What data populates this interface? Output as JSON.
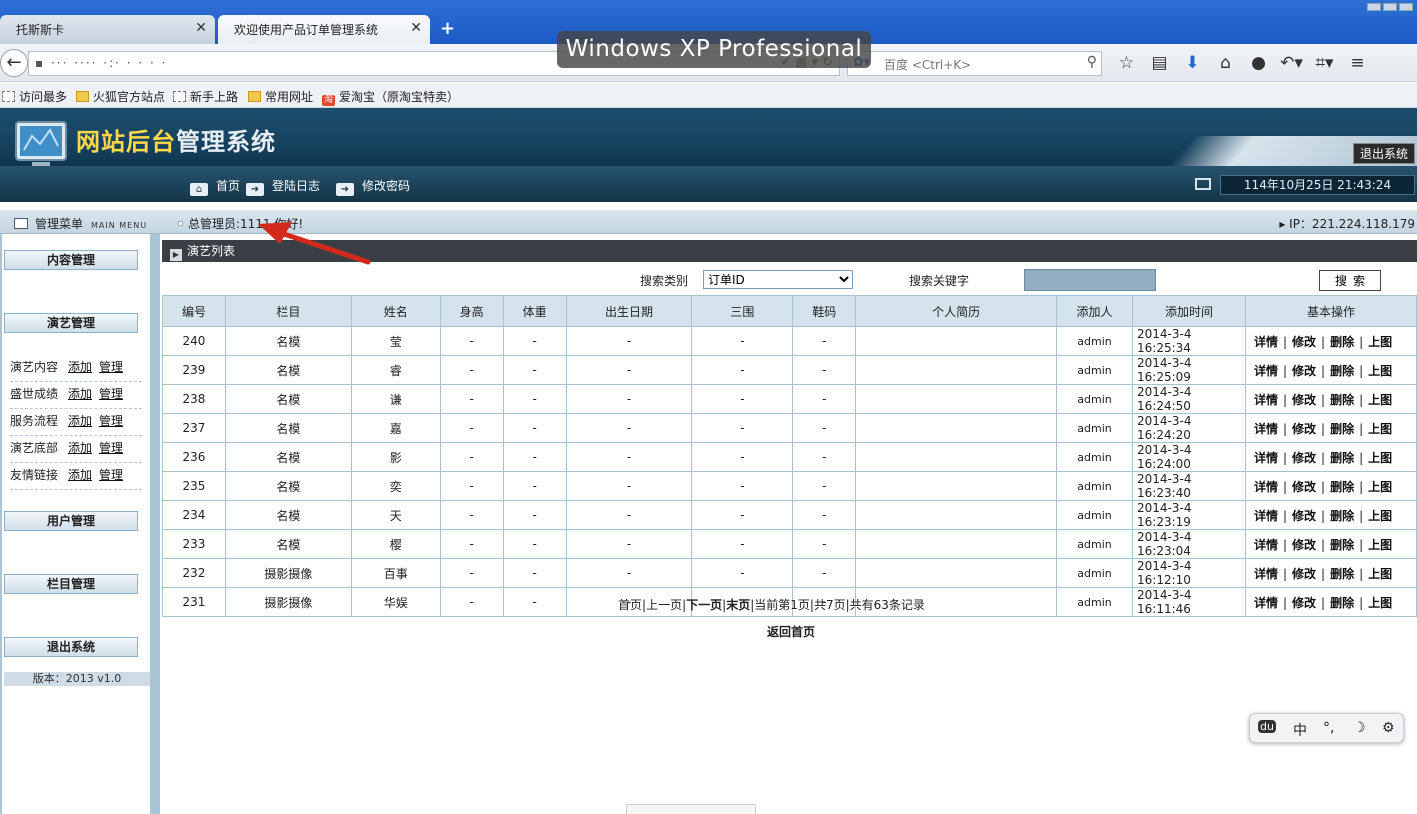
{
  "browser": {
    "tabs": [
      {
        "label": "托斯斯卡",
        "active": false
      },
      {
        "label": "欢迎使用产品订单管理系统",
        "active": true
      }
    ],
    "overlay_banner": "Windows XP Professional",
    "url_masked": "▪ ···   ····  ·:· ·  ·  · ·",
    "search_placeholder": "百度 <Ctrl+K>",
    "bookmarks": [
      "访问最多",
      "火狐官方站点",
      "新手上路",
      "常用网址",
      "爱淘宝（原淘宝特卖）"
    ]
  },
  "header": {
    "logo_part1": "网站后台",
    "logo_part2": "管理系统",
    "logout_label": "退出系统",
    "nav": [
      "首页",
      "登陆日志",
      "修改密码"
    ],
    "datetime": "114年10月25日 21:43:24"
  },
  "welcome_bar": {
    "menu_title": "管理菜单",
    "menu_title_en": "MAIN MENU",
    "greeting": "总管理员:1111 你好!",
    "ip": "IP：221.224.118.179"
  },
  "sidebar": {
    "sections": [
      "内容管理",
      "演艺管理",
      "用户管理",
      "栏目管理",
      "退出系统"
    ],
    "rows": [
      {
        "label": "演艺内容",
        "add": "添加",
        "manage": "管理"
      },
      {
        "label": "盛世成绩",
        "add": "添加",
        "manage": "管理"
      },
      {
        "label": "服务流程",
        "add": "添加",
        "manage": "管理"
      },
      {
        "label": "演艺底部",
        "add": "添加",
        "manage": "管理"
      },
      {
        "label": "友情链接",
        "add": "添加",
        "manage": "管理"
      }
    ],
    "version": "版本：2013 v1.0"
  },
  "main": {
    "panel_title": "演艺列表",
    "search_type_label": "搜索类别",
    "search_type_value": "订单ID",
    "search_keyword_label": "搜索关键字",
    "search_button": "搜索",
    "columns": [
      "编号",
      "栏目",
      "姓名",
      "身高",
      "体重",
      "出生日期",
      "三围",
      "鞋码",
      "个人简历",
      "添加人",
      "添加时间",
      "基本操作"
    ],
    "ops": [
      "详情",
      "修改",
      "删除",
      "上图"
    ],
    "rows": [
      [
        "240",
        "名模",
        "莹",
        "-",
        "-",
        "-",
        "-",
        "-",
        "",
        "admin",
        "2014-3-4 16:25:34"
      ],
      [
        "239",
        "名模",
        "睿",
        "-",
        "-",
        "-",
        "-",
        "-",
        "",
        "admin",
        "2014-3-4 16:25:09"
      ],
      [
        "238",
        "名模",
        "谦",
        "-",
        "-",
        "-",
        "-",
        "-",
        "",
        "admin",
        "2014-3-4 16:24:50"
      ],
      [
        "237",
        "名模",
        "嘉",
        "-",
        "-",
        "-",
        "-",
        "-",
        "",
        "admin",
        "2014-3-4 16:24:20"
      ],
      [
        "236",
        "名模",
        "影",
        "-",
        "-",
        "-",
        "-",
        "-",
        "",
        "admin",
        "2014-3-4 16:24:00"
      ],
      [
        "235",
        "名模",
        "奕",
        "-",
        "-",
        "-",
        "-",
        "-",
        "",
        "admin",
        "2014-3-4 16:23:40"
      ],
      [
        "234",
        "名模",
        "天",
        "-",
        "-",
        "-",
        "-",
        "-",
        "",
        "admin",
        "2014-3-4 16:23:19"
      ],
      [
        "233",
        "名模",
        "樱",
        "-",
        "-",
        "-",
        "-",
        "-",
        "",
        "admin",
        "2014-3-4 16:23:04"
      ],
      [
        "232",
        "摄影摄像",
        "百事",
        "-",
        "-",
        "-",
        "-",
        "-",
        "",
        "admin",
        "2014-3-4 16:12:10"
      ],
      [
        "231",
        "摄影摄像",
        "华娱",
        "-",
        "-",
        "-",
        "-",
        "-",
        "",
        "admin",
        "2014-3-4 16:11:46"
      ]
    ],
    "pager": {
      "first": "首页",
      "prev": "上一页",
      "next": "下一页",
      "last": "末页",
      "current": "当前第1页",
      "total_pages": "共7页",
      "total_records": "共有63条记录"
    },
    "back_home": "返回首页"
  },
  "ime_bar": {
    "items": [
      "du",
      "中",
      "°,",
      "☽",
      "⚙"
    ]
  }
}
